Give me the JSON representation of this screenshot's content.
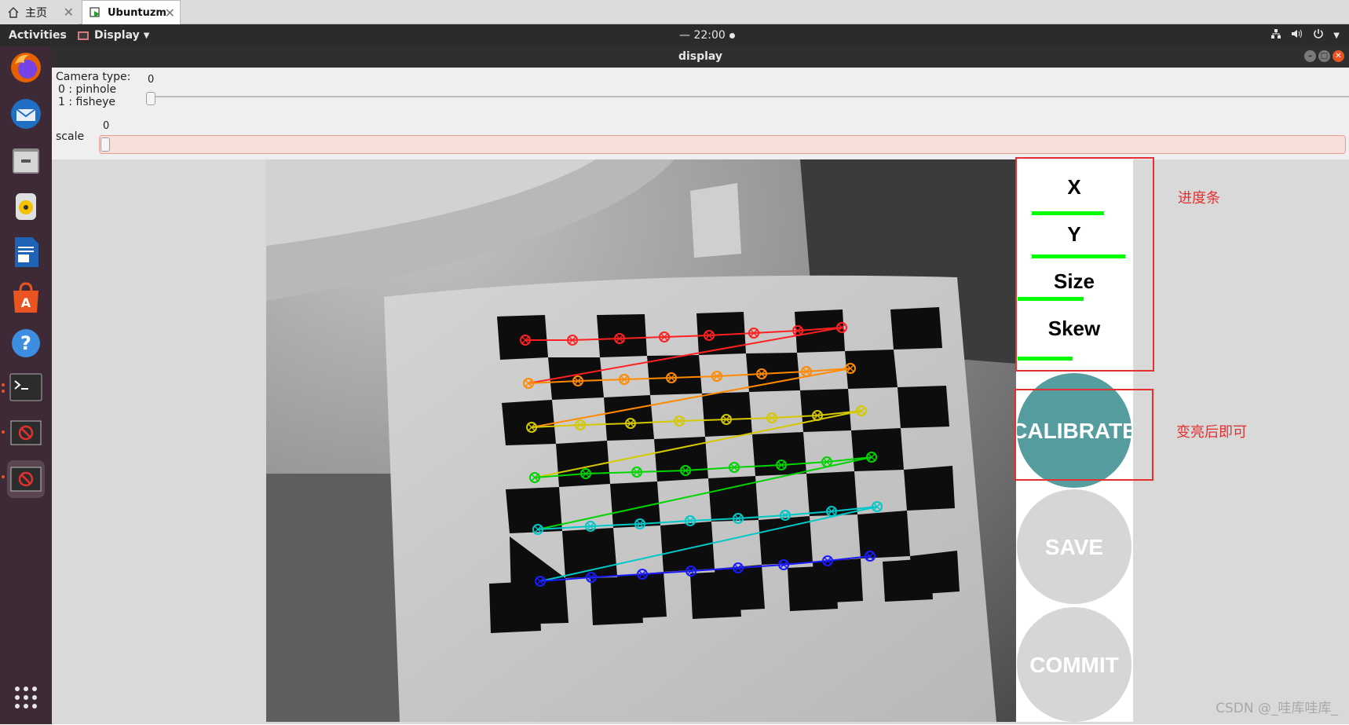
{
  "browser_tabs": [
    {
      "label": "主页",
      "icon": "home-icon"
    },
    {
      "label": "Ubuntuzm",
      "icon": "vm-icon"
    }
  ],
  "top_panel": {
    "activities": "Activities",
    "app_menu": "Display",
    "clock": "— 22:00",
    "system_icons": [
      "network-icon",
      "volume-icon",
      "power-icon"
    ]
  },
  "dock_apps": [
    "firefox-icon",
    "thunderbird-icon",
    "files-icon",
    "rhythmbox-icon",
    "writer-icon",
    "software-icon",
    "help-icon",
    "terminal-icon",
    "display-window-icon",
    "display-window-icon",
    "show-apps-icon"
  ],
  "window": {
    "title": "display"
  },
  "controls": {
    "camera_type": {
      "label_lines": [
        "Camera type:",
        "0 : pinhole",
        "1 : fisheye"
      ],
      "value": "0"
    },
    "scale": {
      "label": "scale",
      "value": "0"
    }
  },
  "calibration_panel": {
    "metrics": [
      {
        "label": "X",
        "progress": 0.68
      },
      {
        "label": "Y",
        "progress": 0.88
      },
      {
        "label": "Size",
        "progress": 0.62
      },
      {
        "label": "Skew",
        "progress": 0.52
      }
    ],
    "buttons": [
      {
        "label": "CALIBRATE",
        "state": "active",
        "color": "#559d9f"
      },
      {
        "label": "SAVE",
        "state": "disabled",
        "color": "#d6d6d6"
      },
      {
        "label": "COMMIT",
        "state": "disabled",
        "color": "#d6d6d6"
      }
    ],
    "progress_color": "#00ff00"
  },
  "annotations": {
    "progress_note": "进度条",
    "calibrate_note": "变亮后即可"
  },
  "watermark": "CSDN @_哇库哇库_",
  "chessboard_row_colors": [
    "#ff2020",
    "#ff8a00",
    "#d4c800",
    "#00d400",
    "#00c8c8",
    "#1a1aff"
  ]
}
